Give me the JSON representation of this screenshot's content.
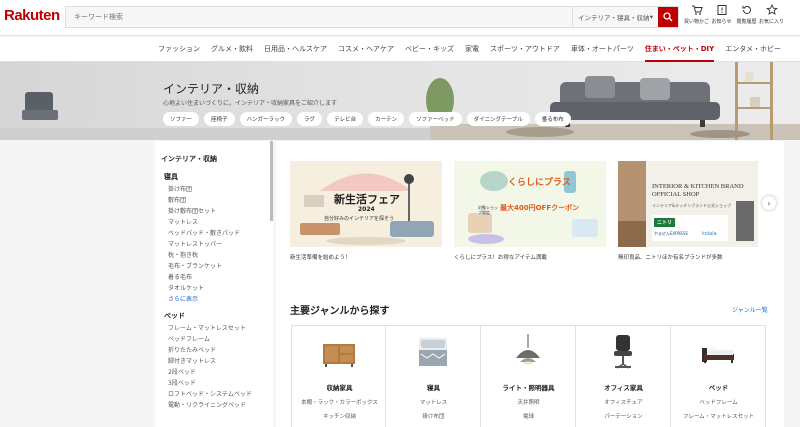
{
  "header": {
    "logo": "Rakuten",
    "search_placeholder": "キーワード検索",
    "search_category": "インテリア・寝具・収納",
    "icons": [
      {
        "label": "買い物かご",
        "icon": "cart-icon"
      },
      {
        "label": "お知らせ",
        "icon": "notification-icon"
      },
      {
        "label": "閲覧履歴",
        "icon": "history-icon"
      },
      {
        "label": "お気に入り",
        "icon": "star-icon"
      }
    ]
  },
  "nav": {
    "items": [
      "ファッション",
      "グルメ・飲料",
      "日用品・ヘルスケア",
      "コスメ・ヘアケア",
      "ベビー・キッズ",
      "家電",
      "スポーツ・アウトドア",
      "車体・オートパーツ",
      "住まい・ペット・DIY",
      "エンタメ・ホビー"
    ],
    "active_index": 8
  },
  "hero": {
    "title": "インテリア・収納",
    "subtitle": "心地よい住まいづくりに。インテリア・収納家具をご紹介します",
    "chips": [
      "ソファー",
      "座椅子",
      "ハンガーラック",
      "ラグ",
      "テレビ台",
      "カーテン",
      "ソファーベッド",
      "ダイニングテーブル",
      "番る布布"
    ]
  },
  "sidebar": {
    "title": "インテリア・収納",
    "sections": [
      {
        "name": "寝具",
        "items": [
          "掛け布団",
          "敷布団",
          "掛け敷布団セット",
          "マットレス",
          "ベッドパッド・敷きパッド",
          "マットレストッパー",
          "枕・抱き枕",
          "毛布・ブランケット",
          "着る毛布",
          "タオルケット"
        ],
        "more": "さらに表示"
      },
      {
        "name": "ベッド",
        "items": [
          "フレーム・マットレスセット",
          "ベッドフレーム",
          "折りたたみベッド",
          "脚付きマットレス",
          "2段ベッド",
          "3段ベッド",
          "ロフトベッド・システムベッド",
          "電動・リクライニングベッド"
        ]
      }
    ]
  },
  "banners": [
    {
      "caption": "新生活準備を始めよう！",
      "title": "新生活フェア",
      "year": "2024",
      "tagline": "自分好みのインテリアを探そう"
    },
    {
      "caption": "くらしにプラス！お得なアイテム満載",
      "title": "くらしにプラス",
      "amount": "最大400円OFFクーポン",
      "note": "対象ショップ限定"
    },
    {
      "caption": "無印良品、ニトリほか有名ブランドが多数",
      "title": "INTERIOR & KITCHEN BRAND OFFICIAL SHOP",
      "subtitle": "インテリア&キッチンブランド公式ショップ",
      "brands": [
        "ニトリ",
        "やまぜんEXPRESS",
        "kolala"
      ]
    }
  ],
  "genres": {
    "title": "主要ジャンルから探す",
    "link": "ジャンル一覧",
    "cards": [
      {
        "name": "収納家具",
        "subs": [
          "本棚・ラック・カラーボックス",
          "キッチン収納"
        ]
      },
      {
        "name": "寝具",
        "subs": [
          "マットレス",
          "掛け布団"
        ]
      },
      {
        "name": "ライト・照明器具",
        "subs": [
          "天井照明",
          "電球"
        ]
      },
      {
        "name": "オフィス家具",
        "subs": [
          "オフィスチェア",
          "パーテーション"
        ]
      },
      {
        "name": "ベッド",
        "subs": [
          "ベッドフレーム",
          "フレーム・マットレスセット"
        ]
      }
    ]
  },
  "colors": {
    "brand": "#bf0000",
    "link": "#1a66c4"
  }
}
